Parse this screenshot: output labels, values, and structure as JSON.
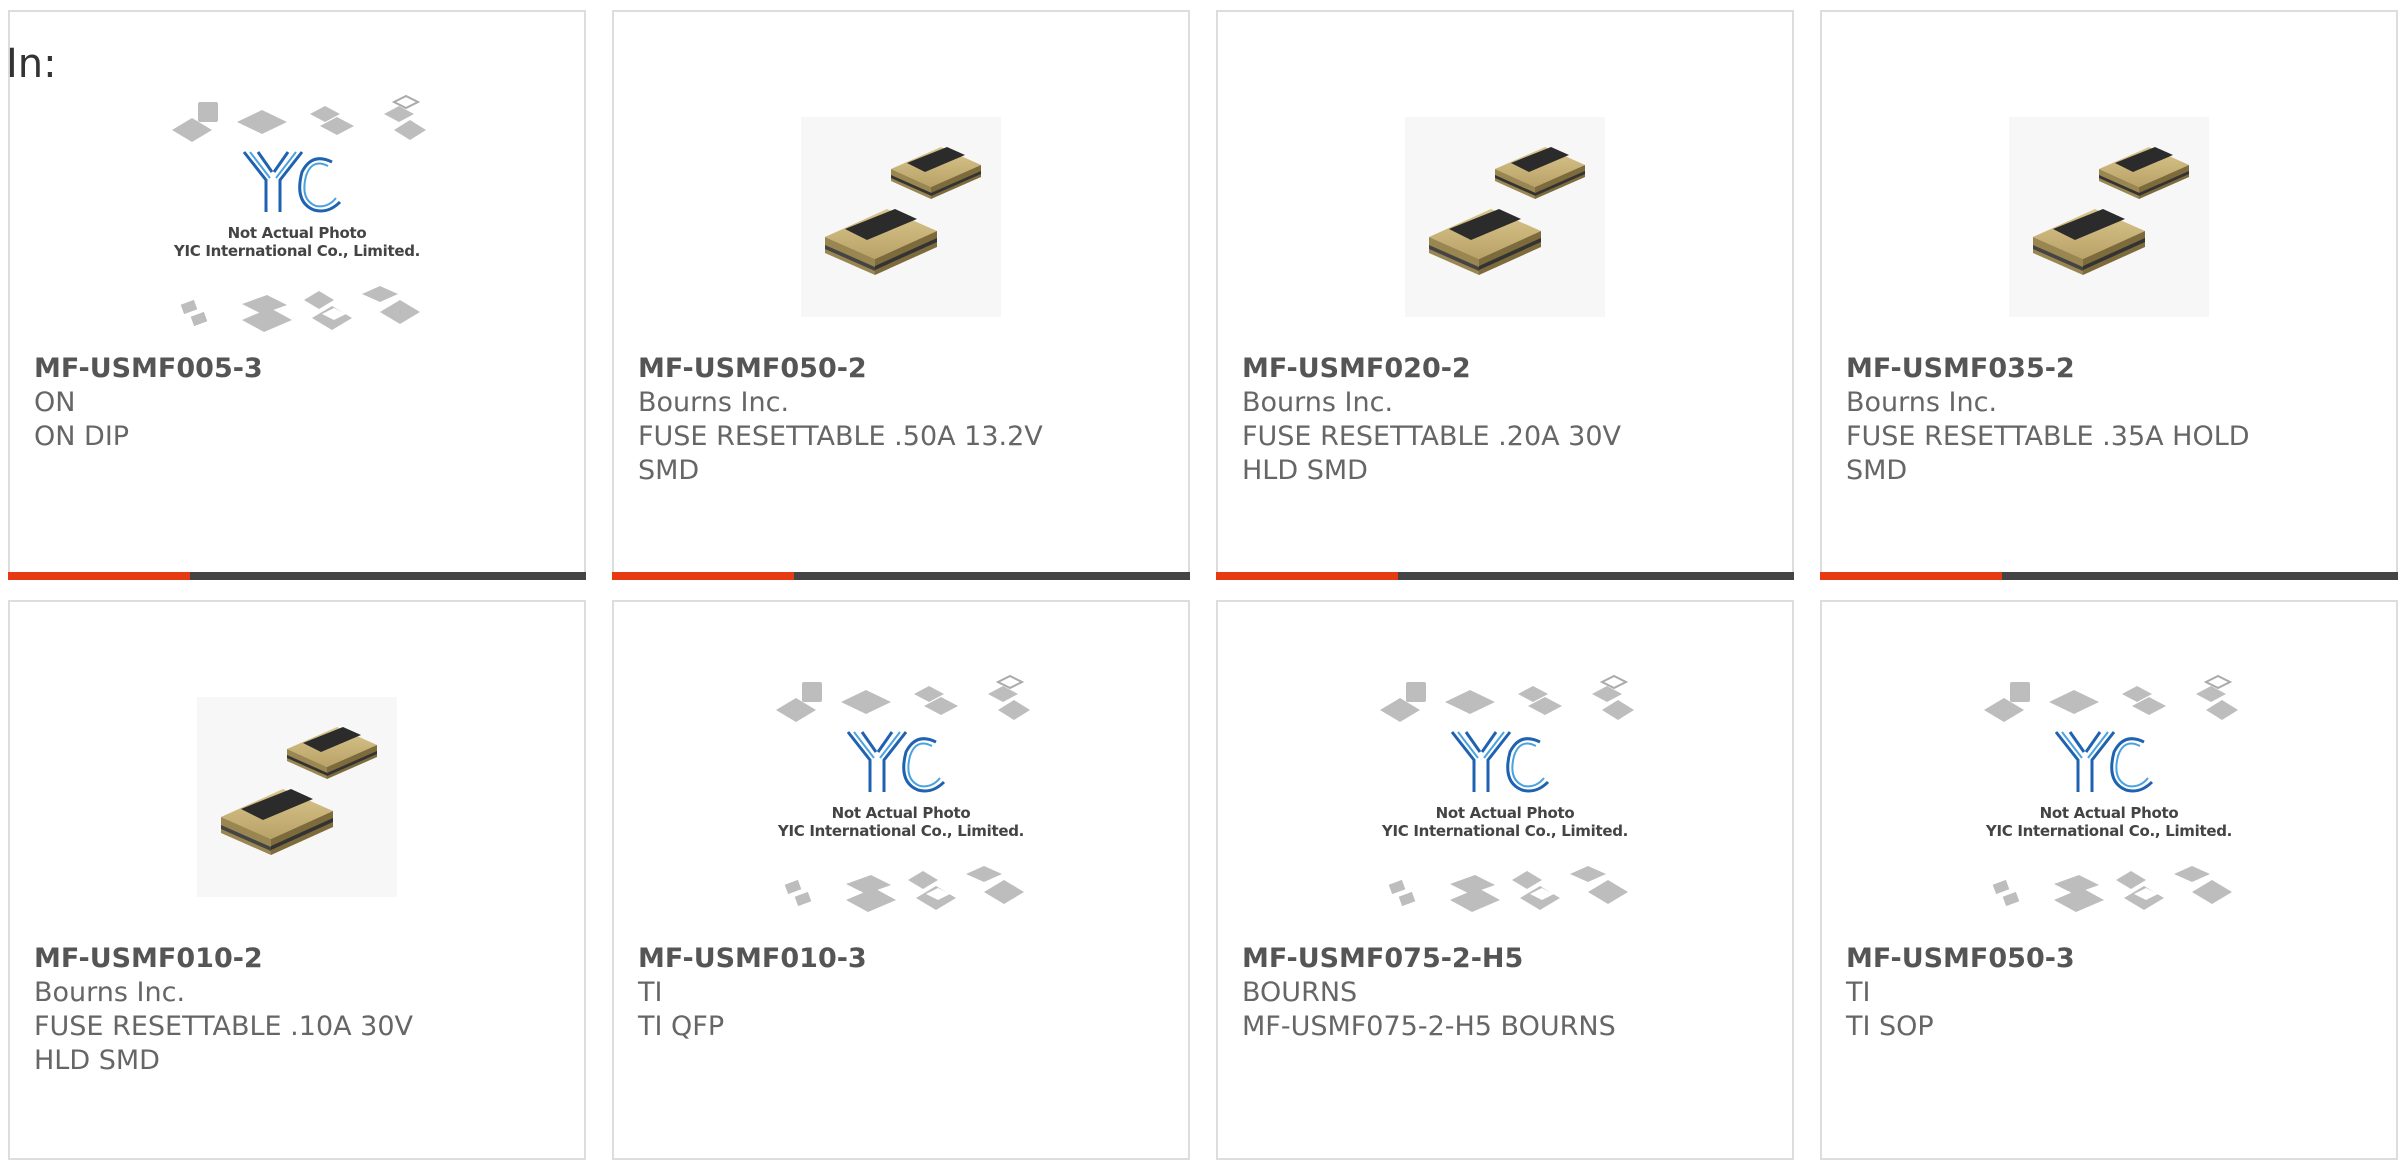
{
  "prefix_label": "In:",
  "colors": {
    "accent": "#e63a12",
    "bar_dark": "#444444",
    "card_border": "#dddddd",
    "text": "#666666"
  },
  "placeholder": {
    "line1": "Not Actual Photo",
    "line2": "YIC International Co., Limited."
  },
  "products": [
    {
      "part_number": "MF-USMF005-3",
      "manufacturer": "ON",
      "description": "ON DIP",
      "image": "not-actual-photo"
    },
    {
      "part_number": "MF-USMF050-2",
      "manufacturer": "Bourns Inc.",
      "description": "FUSE RESETTABLE .50A 13.2V SMD",
      "image": "smd-fuse"
    },
    {
      "part_number": "MF-USMF020-2",
      "manufacturer": "Bourns Inc.",
      "description": "FUSE RESETTABLE .20A 30V HLD SMD",
      "image": "smd-fuse"
    },
    {
      "part_number": "MF-USMF035-2",
      "manufacturer": "Bourns Inc.",
      "description": "FUSE RESETTABLE .35A HOLD SMD",
      "image": "smd-fuse"
    },
    {
      "part_number": "MF-USMF010-2",
      "manufacturer": "Bourns Inc.",
      "description": "FUSE RESETTABLE .10A 30V HLD SMD",
      "image": "smd-fuse"
    },
    {
      "part_number": "MF-USMF010-3",
      "manufacturer": "TI",
      "description": "TI QFP",
      "image": "not-actual-photo"
    },
    {
      "part_number": "MF-USMF075-2-H5",
      "manufacturer": "BOURNS",
      "description": "MF-USMF075-2-H5 BOURNS",
      "image": "not-actual-photo"
    },
    {
      "part_number": "MF-USMF050-3",
      "manufacturer": "TI",
      "description": "TI SOP",
      "image": "not-actual-photo"
    }
  ]
}
